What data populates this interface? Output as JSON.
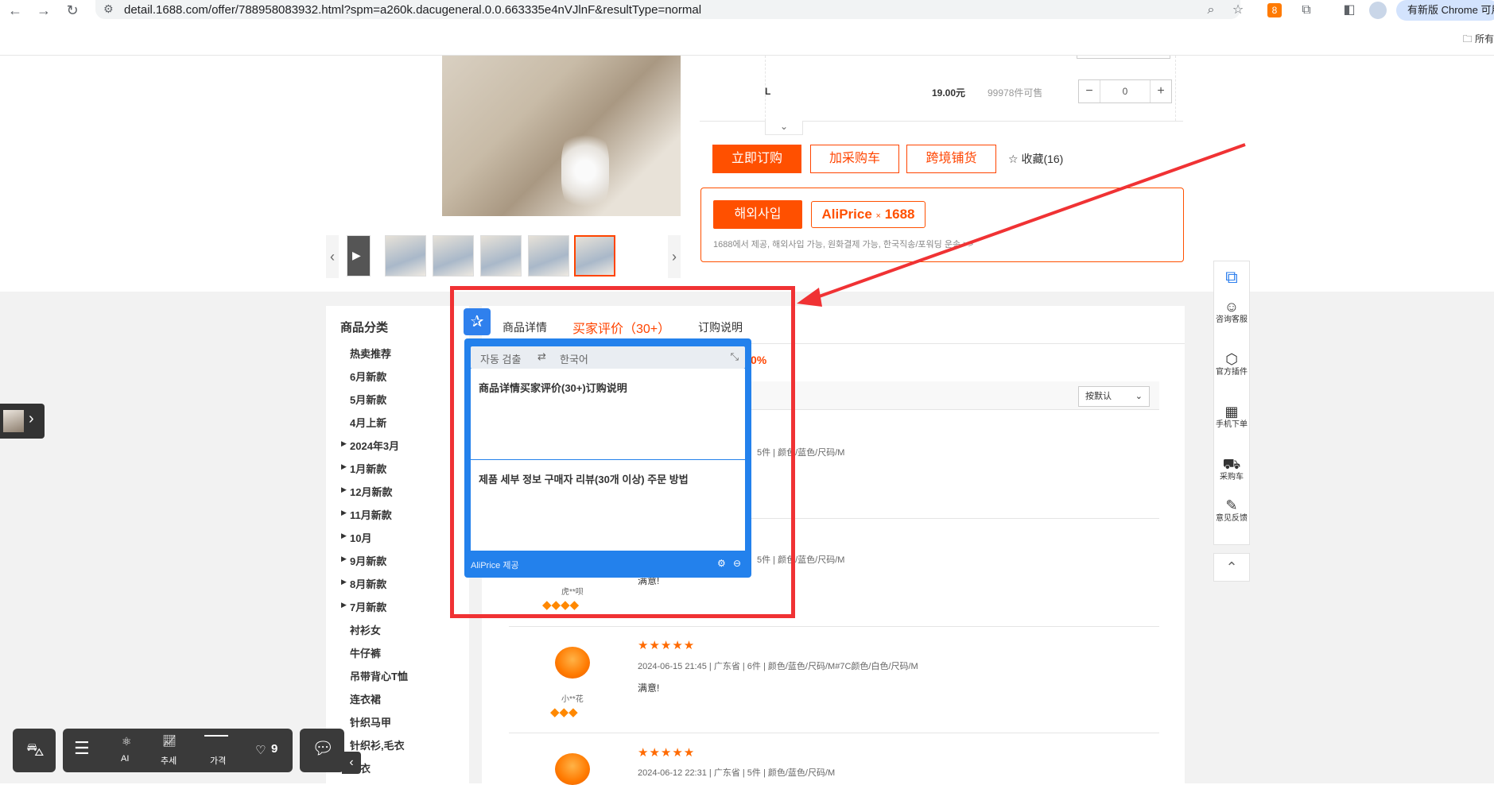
{
  "browser": {
    "url": "detail.1688.com/offer/788958083932.html?spm=a260k.dacugeneral.0.0.663335e4nVJlnF&resultType=normal",
    "update_label": "有新版 Chrome 可用",
    "bookmarks_label": "所有"
  },
  "sku": {
    "size": "L",
    "price": "19.00元",
    "stock": "99978件可售",
    "quantity": "0"
  },
  "actions": {
    "buy_now": "立即订购",
    "add_cart": "加采购车",
    "cross_border": "跨境铺货",
    "favorite": "收藏(16)"
  },
  "aliprice": {
    "overseas_btn": "해외사입",
    "badge_brand": "AliPrice",
    "badge_x": "×",
    "badge_site": "1688",
    "subtitle": "1688에서 제공, 해외사입 가능, 원화결제 가능, 한국직송/포워딩 운송 >>"
  },
  "categories": {
    "title": "商品分类",
    "items": [
      "热卖推荐",
      "6月新款",
      "5月新款",
      "4月上新",
      "2024年3月",
      "1月新款",
      "12月新款",
      "11月新款",
      "10月",
      "9月新款",
      "8月新款",
      "7月新款",
      "衬衫女",
      "牛仔裤",
      "吊带背心T恤",
      "连衣裙",
      "针织马甲",
      "针织衫,毛衣",
      "晒衣"
    ]
  },
  "tabs": {
    "detail": "商品详情",
    "review": "买家评价（30+）",
    "order": "订购说明"
  },
  "reviews": {
    "percent": "0%",
    "sort": "按默认",
    "items": [
      {
        "meta": "5件  |  颜色/蓝色/尺码/M",
        "text": "",
        "nick": "",
        "date": ""
      },
      {
        "meta": "5件  |  颜色/蓝色/尺码/M",
        "text": "满意!",
        "nick": "虎**呗",
        "date": ""
      },
      {
        "meta": "2024-06-15 21:45  |  广东省  |  6件  |  颜色/蓝色/尺码/M#7C颜色/白色/尺码/M",
        "text": "满意!",
        "nick": "小**花",
        "date": ""
      },
      {
        "meta": "2024-06-12 22:31  |  广东省  |  5件  |  颜色/蓝色/尺码/M",
        "text": "",
        "nick": "",
        "date": ""
      }
    ]
  },
  "translator": {
    "source_lang": "자동 검출",
    "swap_icon": "⇄",
    "target_lang": "한국어",
    "source_text": "商品详情买家评价(30+)订购说明",
    "target_text": "제품 세부 정보 구매자 리뷰(30개 이상) 주문 방법",
    "footer": "AliPrice 제공"
  },
  "right_toolbar": {
    "items": [
      {
        "icon": "translate-icon",
        "label": ""
      },
      {
        "icon": "customer-service-icon",
        "label": "咨询客服"
      },
      {
        "icon": "plugin-icon",
        "label": "官方插件"
      },
      {
        "icon": "qr-code-icon",
        "label": "手机下单"
      },
      {
        "icon": "cart-icon",
        "label": "采购车"
      },
      {
        "icon": "feedback-icon",
        "label": "意见反馈"
      }
    ]
  },
  "bottom_toolbar": {
    "ai_label": "AI",
    "trend_label": "추세",
    "price_label": "가격",
    "likes": "9"
  },
  "colors": {
    "accent": "#ff5000",
    "annotation_red": "#f03234",
    "translator_blue": "#2381ec"
  }
}
